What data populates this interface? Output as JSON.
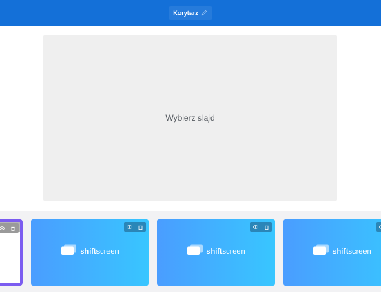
{
  "header": {
    "title": "Korytarz",
    "edit_icon": "pencil-icon"
  },
  "preview": {
    "placeholder": "Wybierz slajd"
  },
  "slides": [
    {
      "selected": true,
      "brand": ""
    },
    {
      "selected": false,
      "brand_bold": "shift",
      "brand_rest": "screen"
    },
    {
      "selected": false,
      "brand_bold": "shift",
      "brand_rest": "screen"
    },
    {
      "selected": false,
      "brand_bold": "shift",
      "brand_rest": "screen"
    }
  ],
  "icons": {
    "preview_toggle": "eye-icon",
    "delete": "trash-icon",
    "logo": "shiftscreen-logo-icon"
  },
  "colors": {
    "header_bg": "#1470d8",
    "selected_border": "#7b5cf0",
    "thumb_gradient_start": "#4a9dff",
    "thumb_gradient_end": "#38c6ff"
  }
}
